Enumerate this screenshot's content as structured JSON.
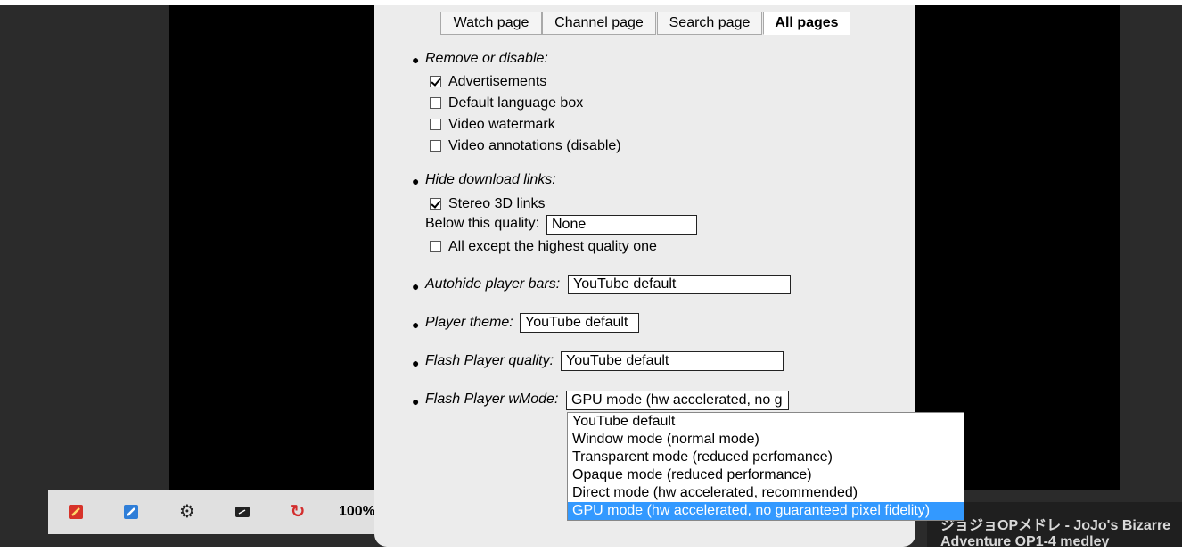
{
  "tabs": [
    {
      "label": "Watch page"
    },
    {
      "label": "Channel page"
    },
    {
      "label": "Search page"
    },
    {
      "label": "All pages",
      "active": true
    }
  ],
  "remove_section": {
    "heading": "Remove or disable:",
    "options": [
      {
        "label": "Advertisements",
        "checked": true
      },
      {
        "label": "Default language box",
        "checked": false
      },
      {
        "label": "Video watermark",
        "checked": false
      },
      {
        "label": "Video annotations (disable)",
        "checked": false
      }
    ]
  },
  "download_section": {
    "heading": "Hide download links:",
    "stereo_label": "Stereo 3D links",
    "stereo_checked": true,
    "quality_label": "Below this quality:",
    "quality_value": "None",
    "highest_label": "All except the highest quality one",
    "highest_checked": false
  },
  "autohide": {
    "label": "Autohide player bars:",
    "value": "YouTube default"
  },
  "theme": {
    "label": "Player theme:",
    "value": "YouTube default"
  },
  "flash_quality": {
    "label": "Flash Player quality:",
    "value": "YouTube default"
  },
  "wmode": {
    "label": "Flash Player wMode:",
    "value": "GPU mode (hw accelerated, no g",
    "options": [
      "YouTube default",
      "Window mode (normal mode)",
      "Transparent mode (reduced perfomance)",
      "Opaque mode (reduced performance)",
      "Direct mode (hw accelerated, recommended)",
      "GPU mode (hw accelerated, no guaranteed pixel fidelity)"
    ],
    "selected_index": 5
  },
  "toolbar": {
    "zoom": "100%",
    "icons": [
      "orange-pencil-icon",
      "blue-wand-icon",
      "gear-icon",
      "screen-icon",
      "reload-icon"
    ]
  },
  "video_title": "ジョジョOPメドレ - JoJo's Bizarre Adventure OP1-4 medley",
  "colors": {
    "selected": "#3399ff",
    "panel": "#ececec",
    "video": "#000000"
  }
}
